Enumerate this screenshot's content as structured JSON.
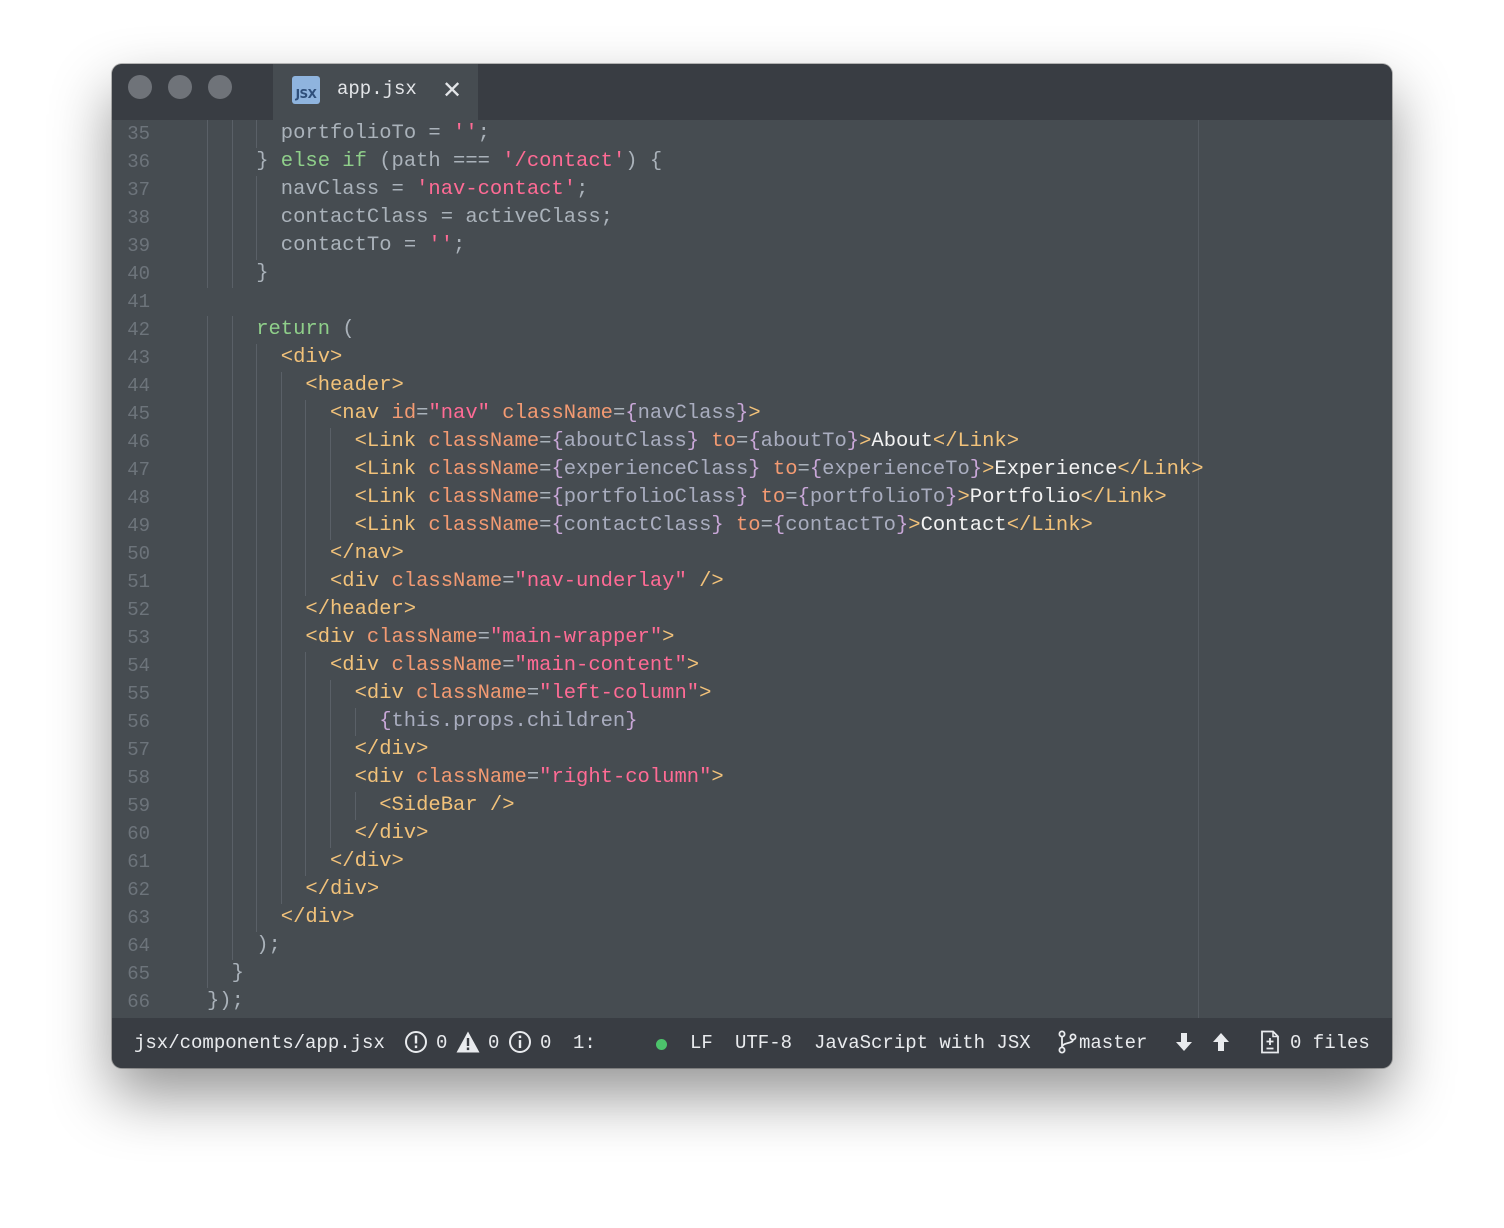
{
  "window": {
    "tab": {
      "icon_text": "JSX",
      "title": "app.jsx",
      "close_glyph": "✕"
    }
  },
  "editor": {
    "lines": [
      {
        "n": "35",
        "indent": 6,
        "tokens": [
          [
            "portfolioTo = ",
            "plain"
          ],
          [
            "''",
            "str"
          ],
          [
            ";",
            "punc"
          ]
        ]
      },
      {
        "n": "36",
        "indent": 4,
        "tokens": [
          [
            "} ",
            "plain"
          ],
          [
            "else if",
            "kw"
          ],
          [
            " (path === ",
            "plain"
          ],
          [
            "'/contact'",
            "str"
          ],
          [
            ") {",
            "plain"
          ]
        ]
      },
      {
        "n": "37",
        "indent": 6,
        "tokens": [
          [
            "navClass = ",
            "plain"
          ],
          [
            "'nav-contact'",
            "str"
          ],
          [
            ";",
            "punc"
          ]
        ]
      },
      {
        "n": "38",
        "indent": 6,
        "tokens": [
          [
            "contactClass = activeClass;",
            "plain"
          ]
        ]
      },
      {
        "n": "39",
        "indent": 6,
        "tokens": [
          [
            "contactTo = ",
            "plain"
          ],
          [
            "''",
            "str"
          ],
          [
            ";",
            "punc"
          ]
        ]
      },
      {
        "n": "40",
        "indent": 4,
        "tokens": [
          [
            "}",
            "plain"
          ]
        ]
      },
      {
        "n": "41",
        "indent": 0,
        "tokens": []
      },
      {
        "n": "42",
        "indent": 4,
        "tokens": [
          [
            "return",
            "kw"
          ],
          [
            " (",
            "plain"
          ]
        ]
      },
      {
        "n": "43",
        "indent": 6,
        "tokens": [
          [
            "<div>",
            "tag"
          ]
        ]
      },
      {
        "n": "44",
        "indent": 8,
        "tokens": [
          [
            "<header>",
            "tag"
          ]
        ]
      },
      {
        "n": "45",
        "indent": 10,
        "tokens": [
          [
            "<nav ",
            "tag"
          ],
          [
            "id",
            "attr"
          ],
          [
            "=",
            "punc"
          ],
          [
            "\"nav\"",
            "str"
          ],
          [
            " ",
            "plain"
          ],
          [
            "className",
            "attr"
          ],
          [
            "=",
            "punc"
          ],
          [
            "{",
            "brace"
          ],
          [
            "navClass",
            "var"
          ],
          [
            "}",
            "brace"
          ],
          [
            ">",
            "tag"
          ]
        ]
      },
      {
        "n": "46",
        "indent": 12,
        "tokens": [
          [
            "<Link ",
            "tag"
          ],
          [
            "className",
            "attr"
          ],
          [
            "=",
            "punc"
          ],
          [
            "{",
            "brace"
          ],
          [
            "aboutClass",
            "var"
          ],
          [
            "}",
            "brace"
          ],
          [
            " ",
            "plain"
          ],
          [
            "to",
            "attr"
          ],
          [
            "=",
            "punc"
          ],
          [
            "{",
            "brace"
          ],
          [
            "aboutTo",
            "var"
          ],
          [
            "}",
            "brace"
          ],
          [
            ">",
            "tag"
          ],
          [
            "About",
            "txt"
          ],
          [
            "</Link>",
            "tag"
          ]
        ]
      },
      {
        "n": "47",
        "indent": 12,
        "tokens": [
          [
            "<Link ",
            "tag"
          ],
          [
            "className",
            "attr"
          ],
          [
            "=",
            "punc"
          ],
          [
            "{",
            "brace"
          ],
          [
            "experienceClass",
            "var"
          ],
          [
            "}",
            "brace"
          ],
          [
            " ",
            "plain"
          ],
          [
            "to",
            "attr"
          ],
          [
            "=",
            "punc"
          ],
          [
            "{",
            "brace"
          ],
          [
            "experienceTo",
            "var"
          ],
          [
            "}",
            "brace"
          ],
          [
            ">",
            "tag"
          ],
          [
            "Experience",
            "txt"
          ],
          [
            "</Link>",
            "tag"
          ]
        ]
      },
      {
        "n": "48",
        "indent": 12,
        "tokens": [
          [
            "<Link ",
            "tag"
          ],
          [
            "className",
            "attr"
          ],
          [
            "=",
            "punc"
          ],
          [
            "{",
            "brace"
          ],
          [
            "portfolioClass",
            "var"
          ],
          [
            "}",
            "brace"
          ],
          [
            " ",
            "plain"
          ],
          [
            "to",
            "attr"
          ],
          [
            "=",
            "punc"
          ],
          [
            "{",
            "brace"
          ],
          [
            "portfolioTo",
            "var"
          ],
          [
            "}",
            "brace"
          ],
          [
            ">",
            "tag"
          ],
          [
            "Portfolio",
            "txt"
          ],
          [
            "</Link>",
            "tag"
          ]
        ]
      },
      {
        "n": "49",
        "indent": 12,
        "tokens": [
          [
            "<Link ",
            "tag"
          ],
          [
            "className",
            "attr"
          ],
          [
            "=",
            "punc"
          ],
          [
            "{",
            "brace"
          ],
          [
            "contactClass",
            "var"
          ],
          [
            "}",
            "brace"
          ],
          [
            " ",
            "plain"
          ],
          [
            "to",
            "attr"
          ],
          [
            "=",
            "punc"
          ],
          [
            "{",
            "brace"
          ],
          [
            "contactTo",
            "var"
          ],
          [
            "}",
            "brace"
          ],
          [
            ">",
            "tag"
          ],
          [
            "Contact",
            "txt"
          ],
          [
            "</Link>",
            "tag"
          ]
        ]
      },
      {
        "n": "50",
        "indent": 10,
        "tokens": [
          [
            "</nav>",
            "tag"
          ]
        ]
      },
      {
        "n": "51",
        "indent": 10,
        "tokens": [
          [
            "<div ",
            "tag"
          ],
          [
            "className",
            "attr"
          ],
          [
            "=",
            "punc"
          ],
          [
            "\"nav-underlay\"",
            "str"
          ],
          [
            " />",
            "tag"
          ]
        ]
      },
      {
        "n": "52",
        "indent": 8,
        "tokens": [
          [
            "</header>",
            "tag"
          ]
        ]
      },
      {
        "n": "53",
        "indent": 8,
        "tokens": [
          [
            "<div ",
            "tag"
          ],
          [
            "className",
            "attr"
          ],
          [
            "=",
            "punc"
          ],
          [
            "\"main-wrapper\"",
            "str"
          ],
          [
            ">",
            "tag"
          ]
        ]
      },
      {
        "n": "54",
        "indent": 10,
        "tokens": [
          [
            "<div ",
            "tag"
          ],
          [
            "className",
            "attr"
          ],
          [
            "=",
            "punc"
          ],
          [
            "\"main-content\"",
            "str"
          ],
          [
            ">",
            "tag"
          ]
        ]
      },
      {
        "n": "55",
        "indent": 12,
        "tokens": [
          [
            "<div ",
            "tag"
          ],
          [
            "className",
            "attr"
          ],
          [
            "=",
            "punc"
          ],
          [
            "\"left-column\"",
            "str"
          ],
          [
            ">",
            "tag"
          ]
        ]
      },
      {
        "n": "56",
        "indent": 14,
        "tokens": [
          [
            "{",
            "brace"
          ],
          [
            "this.props.children",
            "var"
          ],
          [
            "}",
            "brace"
          ]
        ]
      },
      {
        "n": "57",
        "indent": 12,
        "tokens": [
          [
            "</div>",
            "tag"
          ]
        ]
      },
      {
        "n": "58",
        "indent": 12,
        "tokens": [
          [
            "<div ",
            "tag"
          ],
          [
            "className",
            "attr"
          ],
          [
            "=",
            "punc"
          ],
          [
            "\"right-column\"",
            "str"
          ],
          [
            ">",
            "tag"
          ]
        ]
      },
      {
        "n": "59",
        "indent": 14,
        "tokens": [
          [
            "<SideBar />",
            "tag"
          ]
        ]
      },
      {
        "n": "60",
        "indent": 12,
        "tokens": [
          [
            "</div>",
            "tag"
          ]
        ]
      },
      {
        "n": "61",
        "indent": 10,
        "tokens": [
          [
            "</div>",
            "tag"
          ]
        ]
      },
      {
        "n": "62",
        "indent": 8,
        "tokens": [
          [
            "</div>",
            "tag"
          ]
        ]
      },
      {
        "n": "63",
        "indent": 6,
        "tokens": [
          [
            "</div>",
            "tag"
          ]
        ]
      },
      {
        "n": "64",
        "indent": 4,
        "tokens": [
          [
            ");",
            "plain"
          ]
        ]
      },
      {
        "n": "65",
        "indent": 2,
        "tokens": [
          [
            "}",
            "plain"
          ]
        ]
      },
      {
        "n": "66",
        "indent": 0,
        "tokens": [
          [
            "});",
            "plain"
          ]
        ]
      }
    ]
  },
  "colors": {
    "plain": "#aab2ba",
    "kw": "#8fcf8a",
    "str": "#ff6b95",
    "tag": "#f2c27a",
    "attr": "#f39a72",
    "brace": "#c9a7d8",
    "var": "#a9adbf",
    "txt": "#f2f2f2",
    "punc": "#aab2ba"
  },
  "statusbar": {
    "file_path": "jsx/components/app.jsx",
    "errors": "0",
    "warnings": "0",
    "infos": "0",
    "cursor": "1:",
    "line_ending": "LF",
    "encoding": "UTF-8",
    "grammar": "JavaScript with JSX",
    "branch": "master",
    "changed_files": "0 files"
  }
}
